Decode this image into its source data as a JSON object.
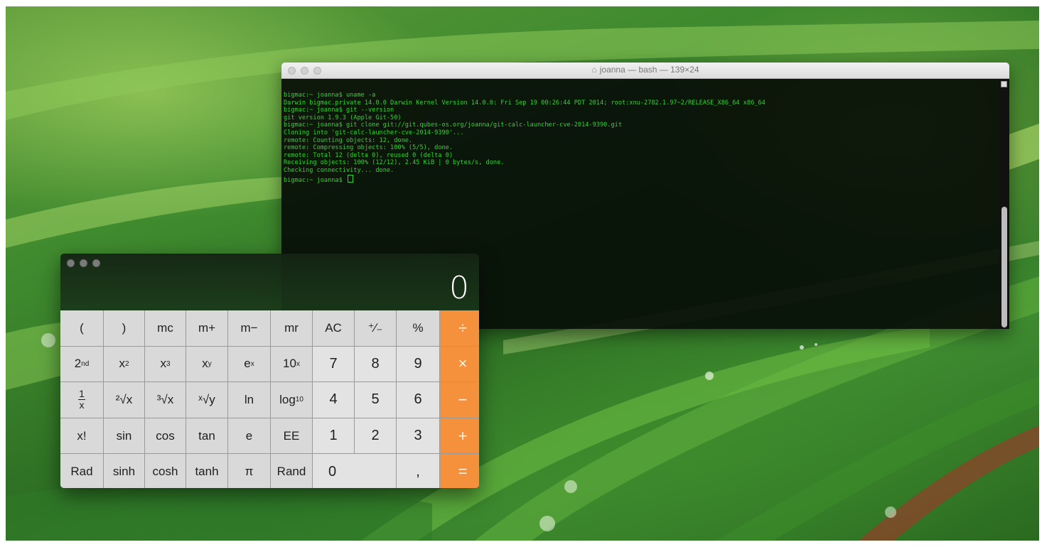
{
  "terminal": {
    "title": "joanna — bash — 139×24",
    "lines": [
      "bigmac:~ joanna$ uname -a",
      "Darwin bigmac.private 14.0.0 Darwin Kernel Version 14.0.0: Fri Sep 19 00:26:44 PDT 2014; root:xnu-2782.1.97~2/RELEASE_X86_64 x86_64",
      "bigmac:~ joanna$ git --version",
      "git version 1.9.3 (Apple Git-50)",
      "bigmac:~ joanna$ git clone git://git.qubes-os.org/joanna/git-calc-launcher-cve-2014-9390.git",
      "Cloning into 'git-calc-launcher-cve-2014-9390'...",
      "remote: Counting objects: 12, done.",
      "remote: Compressing objects: 100% (5/5), done.",
      "remote: Total 12 (delta 0), reused 0 (delta 0)",
      "Receiving objects: 100% (12/12), 2.45 KiB | 0 bytes/s, done.",
      "Checking connectivity... done."
    ],
    "prompt": "bigmac:~ joanna$ "
  },
  "calculator": {
    "display": "0",
    "keys": [
      {
        "name": "key-open-paren",
        "label": "(",
        "kind": "fn"
      },
      {
        "name": "key-close-paren",
        "label": ")",
        "kind": "fn"
      },
      {
        "name": "key-mc",
        "label": "mc",
        "kind": "fn"
      },
      {
        "name": "key-m-plus",
        "label": "m+",
        "kind": "fn"
      },
      {
        "name": "key-m-minus",
        "label": "m−",
        "kind": "fn"
      },
      {
        "name": "key-mr",
        "label": "mr",
        "kind": "fn"
      },
      {
        "name": "key-ac",
        "label": "AC",
        "kind": "fn"
      },
      {
        "name": "key-plus-minus",
        "label": "⁺∕₋",
        "kind": "fn"
      },
      {
        "name": "key-percent",
        "label": "%",
        "kind": "fn"
      },
      {
        "name": "key-divide",
        "label": "÷",
        "kind": "op"
      },
      {
        "name": "key-2nd",
        "base": "2",
        "sup": "nd",
        "kind": "fn"
      },
      {
        "name": "key-x-squared",
        "base": "x",
        "sup": "2",
        "kind": "fn"
      },
      {
        "name": "key-x-cubed",
        "base": "x",
        "sup": "3",
        "kind": "fn"
      },
      {
        "name": "key-x-pow-y",
        "base": "x",
        "sup": "y",
        "kind": "fn"
      },
      {
        "name": "key-e-pow-x",
        "base": "e",
        "sup": "x",
        "kind": "fn"
      },
      {
        "name": "key-ten-pow-x",
        "base": "10",
        "sup": "x",
        "kind": "fn"
      },
      {
        "name": "key-7",
        "label": "7",
        "kind": "num"
      },
      {
        "name": "key-8",
        "label": "8",
        "kind": "num"
      },
      {
        "name": "key-9",
        "label": "9",
        "kind": "num"
      },
      {
        "name": "key-multiply",
        "label": "×",
        "kind": "op"
      },
      {
        "name": "key-reciprocal",
        "num": "1",
        "den": "x",
        "kind": "frac"
      },
      {
        "name": "key-square-root",
        "label": "²√x",
        "kind": "fn"
      },
      {
        "name": "key-cube-root",
        "label": "³√x",
        "kind": "fn"
      },
      {
        "name": "key-y-root",
        "label": "ˣ√y",
        "kind": "fn"
      },
      {
        "name": "key-ln",
        "label": "ln",
        "kind": "fn"
      },
      {
        "name": "key-log10",
        "base": "log",
        "sub": "10",
        "kind": "fn"
      },
      {
        "name": "key-4",
        "label": "4",
        "kind": "num"
      },
      {
        "name": "key-5",
        "label": "5",
        "kind": "num"
      },
      {
        "name": "key-6",
        "label": "6",
        "kind": "num"
      },
      {
        "name": "key-minus",
        "label": "−",
        "kind": "op"
      },
      {
        "name": "key-factorial",
        "label": "x!",
        "kind": "fn"
      },
      {
        "name": "key-sin",
        "label": "sin",
        "kind": "fn"
      },
      {
        "name": "key-cos",
        "label": "cos",
        "kind": "fn"
      },
      {
        "name": "key-tan",
        "label": "tan",
        "kind": "fn"
      },
      {
        "name": "key-e",
        "label": "e",
        "kind": "fn"
      },
      {
        "name": "key-ee",
        "label": "EE",
        "kind": "fn"
      },
      {
        "name": "key-1",
        "label": "1",
        "kind": "num"
      },
      {
        "name": "key-2",
        "label": "2",
        "kind": "num"
      },
      {
        "name": "key-3",
        "label": "3",
        "kind": "num"
      },
      {
        "name": "key-plus",
        "label": "+",
        "kind": "op"
      },
      {
        "name": "key-rad",
        "label": "Rad",
        "kind": "fn"
      },
      {
        "name": "key-sinh",
        "label": "sinh",
        "kind": "fn"
      },
      {
        "name": "key-cosh",
        "label": "cosh",
        "kind": "fn"
      },
      {
        "name": "key-tanh",
        "label": "tanh",
        "kind": "fn"
      },
      {
        "name": "key-pi",
        "label": "π",
        "kind": "fn"
      },
      {
        "name": "key-rand",
        "label": "Rand",
        "kind": "fn"
      },
      {
        "name": "key-0",
        "label": "0",
        "kind": "zero"
      },
      {
        "name": "key-decimal",
        "label": ",",
        "kind": "num"
      },
      {
        "name": "key-equals",
        "label": "=",
        "kind": "op"
      }
    ]
  }
}
